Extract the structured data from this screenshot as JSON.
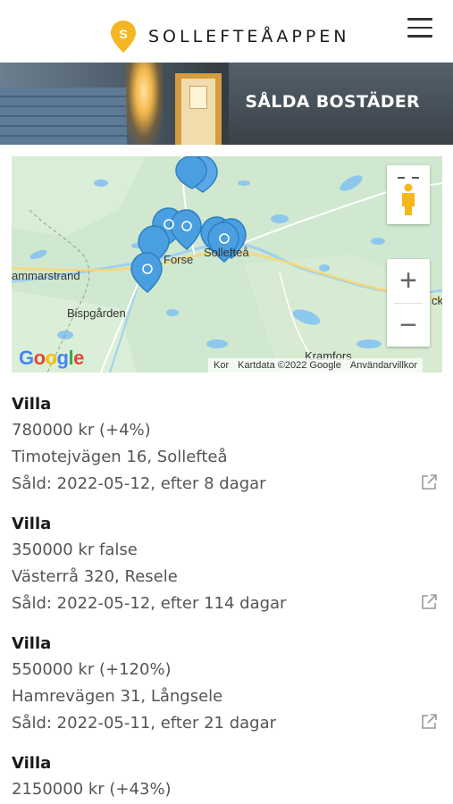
{
  "header": {
    "brand": "SOLLEFTEÅAPPEN",
    "logo_letter": "S",
    "accent_color": "#f5b623"
  },
  "hero": {
    "title": "SÅLDA BOSTÄDER"
  },
  "map": {
    "labels": {
      "forse": "Forse",
      "sollefteå": "Solleftеå",
      "hammarstrand": "ammarstrand",
      "bispgarden": "Bispgården",
      "kramfors": "Kramfors",
      "edge_right": "ck",
      "edge_bottom": "Kor"
    },
    "attribution": {
      "kartdata": "Kartdata ©2022 Google",
      "villkor": "Användarvillkor"
    },
    "google_logo": [
      "G",
      "o",
      "o",
      "g",
      "l",
      "e"
    ],
    "marker_color": "#4a9fe0",
    "zoom_in_label": "+",
    "zoom_out_label": "−"
  },
  "listings": [
    {
      "type": "Villa",
      "price": "780000 kr (+4%)",
      "address": "Timotejvägen 16, Sollefteå",
      "sold": "Såld: 2022-05-12, efter 8 dagar"
    },
    {
      "type": "Villa",
      "price": "350000 kr false",
      "address": "Västerrå 320, Resele",
      "sold": "Såld: 2022-05-12, efter 114 dagar"
    },
    {
      "type": "Villa",
      "price": "550000 kr (+120%)",
      "address": "Hamrevägen 31, Långsele",
      "sold": "Såld: 2022-05-11, efter 21 dagar"
    },
    {
      "type": "Villa",
      "price": "2150000 kr (+43%)"
    }
  ]
}
